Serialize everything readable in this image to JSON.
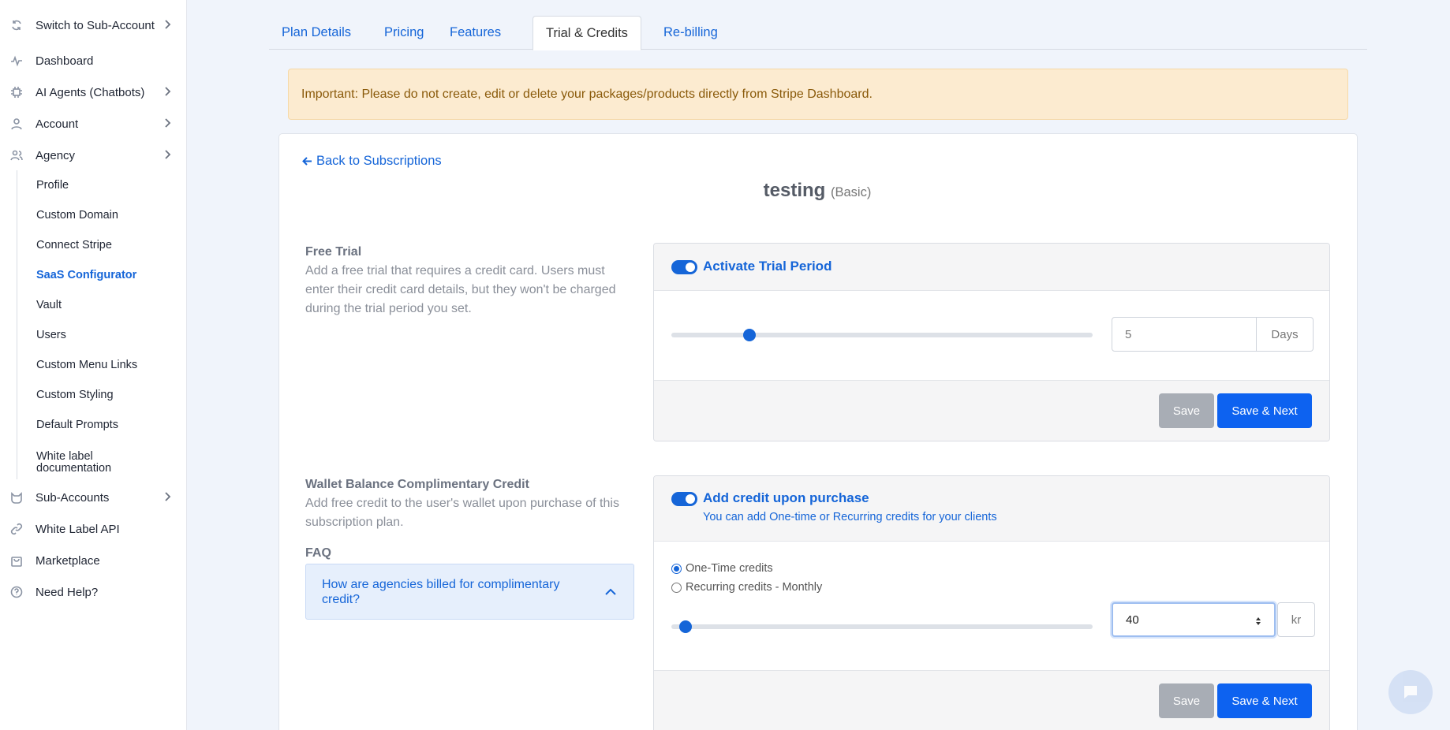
{
  "sidebar": {
    "items": [
      {
        "label": "Switch to Sub-Account",
        "icon": "refresh-icon"
      },
      {
        "label": "Dashboard",
        "icon": "activity-icon"
      },
      {
        "label": "AI Agents (Chatbots)",
        "icon": "chip-icon"
      },
      {
        "label": "Account",
        "icon": "user-icon"
      },
      {
        "label": "Agency",
        "icon": "users-icon"
      }
    ],
    "agency_sub": [
      {
        "label": "Profile"
      },
      {
        "label": "Custom Domain"
      },
      {
        "label": "Connect Stripe"
      },
      {
        "label": "SaaS Configurator"
      },
      {
        "label": "Vault"
      },
      {
        "label": "Users"
      },
      {
        "label": "Custom Menu Links"
      },
      {
        "label": "Custom Styling"
      },
      {
        "label": "Default Prompts"
      },
      {
        "label": "White label documentation"
      }
    ],
    "bottom_items": [
      {
        "label": "Sub-Accounts",
        "icon": "cat-icon"
      },
      {
        "label": "White Label API",
        "icon": "link-icon"
      },
      {
        "label": "Marketplace",
        "icon": "bag-icon"
      },
      {
        "label": "Need Help?",
        "icon": "help-icon"
      }
    ]
  },
  "tabs": [
    {
      "label": "Plan Details"
    },
    {
      "label": "Pricing"
    },
    {
      "label": "Features"
    },
    {
      "label": "Trial & Credits"
    },
    {
      "label": "Re-billing"
    }
  ],
  "alert": "Important: Please do not create, edit or delete your packages/products directly from Stripe Dashboard.",
  "back_link": "Back to Subscriptions",
  "plan": {
    "name": "testing",
    "tier": "(Basic)"
  },
  "trial": {
    "label": "Free Trial",
    "desc": "Add a free trial that requires a credit card. Users must enter their credit card details, but they won't be charged during the trial period you set.",
    "toggle_label": "Activate Trial Period",
    "days_value": "5",
    "days_unit": "Days",
    "slider_fraction": 0.175,
    "save": "Save",
    "save_next": "Save & Next"
  },
  "credit": {
    "label": "Wallet Balance Complimentary Credit",
    "desc": "Add free credit to the user's wallet upon purchase of this subscription plan.",
    "toggle_label": "Add credit upon purchase",
    "toggle_hint": "You can add One-time or Recurring credits for your clients",
    "radio_one_time": "One-Time credits",
    "radio_recurring": "Recurring credits - Monthly",
    "amount_value": "40",
    "currency": "kr",
    "slider_fraction": 0.02,
    "save": "Save",
    "save_next": "Save & Next"
  },
  "faq": {
    "title": "FAQ",
    "question": "How are agencies billed for complimentary credit?"
  }
}
